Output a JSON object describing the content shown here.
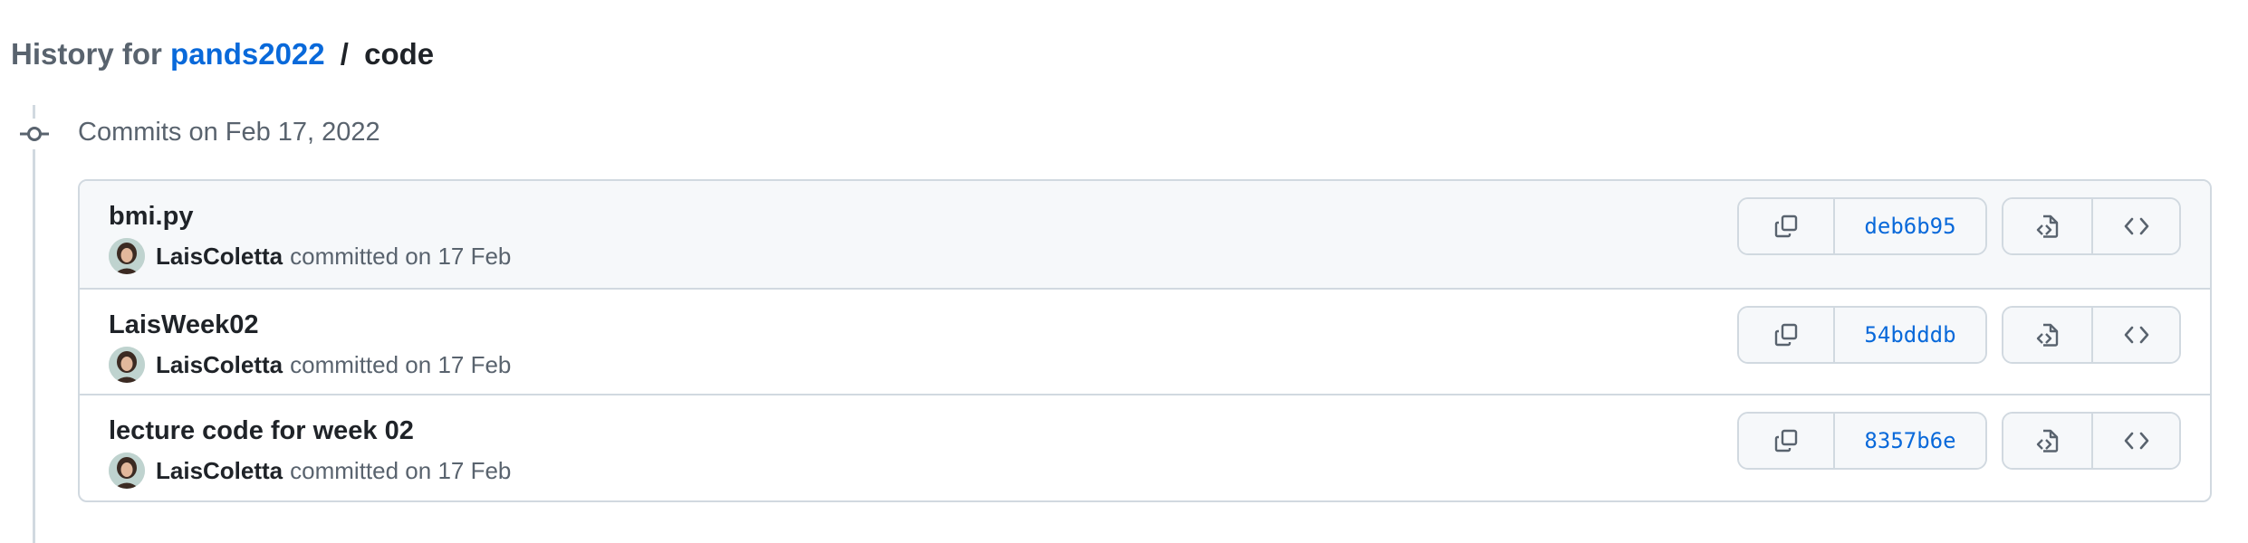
{
  "header": {
    "prefix": "History for",
    "repo": "pands2022",
    "separator": "/",
    "path": "code"
  },
  "timeline": {
    "heading": "Commits on Feb 17, 2022"
  },
  "commits": [
    {
      "title": "bmi.py",
      "author": "LaisColetta",
      "committed_text": "committed on 17 Feb",
      "sha": "deb6b95"
    },
    {
      "title": "LaisWeek02",
      "author": "LaisColetta",
      "committed_text": "committed on 17 Feb",
      "sha": "54bdddb"
    },
    {
      "title": "lecture code for week 02",
      "author": "LaisColetta",
      "committed_text": "committed on 17 Feb",
      "sha": "8357b6e"
    }
  ],
  "icons": {
    "marker": "git-commit-icon",
    "copy": "copy-icon",
    "browse_files": "file-code-icon",
    "browse_code": "code-icon"
  },
  "colors": {
    "link": "#0969da",
    "muted_text": "#59636e",
    "border": "#d1d9e0",
    "button_bg": "#f6f8fa"
  }
}
